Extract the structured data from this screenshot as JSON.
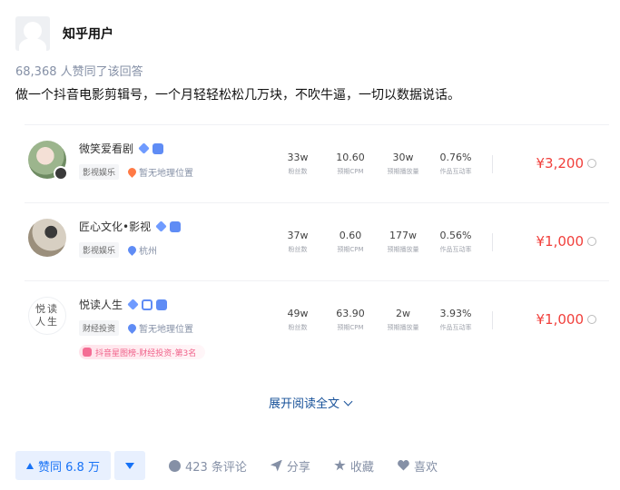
{
  "author": {
    "name": "知乎用户"
  },
  "vote_summary": "68,368 人赞同了该回答",
  "answer_text": "做一个抖音电影剪辑号，一个月轻轻松松几万块，不吹牛逼，一切以数据说话。",
  "stat_labels": [
    "粉丝数",
    "预期CPM",
    "预期播放量",
    "作品互动率"
  ],
  "cards": [
    {
      "name": "微笑爱看剧",
      "tag": "影视娱乐",
      "location": "暂无地理位置",
      "fans": "33w",
      "cpm": "10.60",
      "plays": "30w",
      "rate": "0.76%",
      "price": "¥3,200"
    },
    {
      "name": "匠心文化•影视",
      "tag": "影视娱乐",
      "location": "杭州",
      "fans": "37w",
      "cpm": "0.60",
      "plays": "177w",
      "rate": "0.56%",
      "price": "¥1,000"
    },
    {
      "name": "悦读人生",
      "avatar_text": [
        "悦读",
        "人生"
      ],
      "tag": "财经投资",
      "location": "暂无地理位置",
      "fans": "49w",
      "cpm": "63.90",
      "plays": "2w",
      "rate": "3.93%",
      "price": "¥1,000",
      "rank": "抖音星图榜-财经投资-第3名"
    }
  ],
  "expand_label": "展开阅读全文",
  "actions": {
    "upvote": "赞同 6.8 万",
    "comments": "423 条评论",
    "share": "分享",
    "favorite": "收藏",
    "like": "喜欢"
  },
  "colors": {
    "accent": "#1772f6",
    "price": "#f1403c",
    "link": "#175199"
  }
}
